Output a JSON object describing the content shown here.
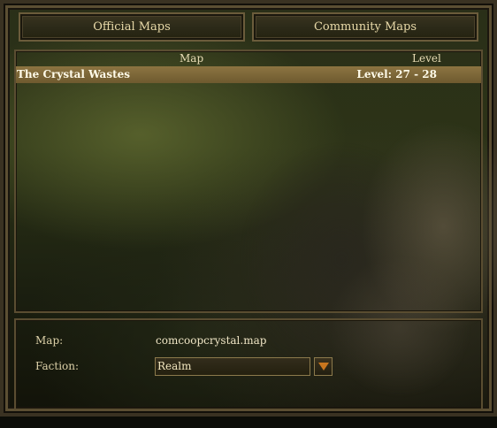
{
  "tabs": {
    "official": "Official Maps",
    "community": "Community Maps"
  },
  "table": {
    "headers": {
      "map": "Map",
      "level": "Level"
    },
    "rows": [
      {
        "name": "The Crystal Wastes",
        "level": "Level: 27 - 28"
      }
    ]
  },
  "details": {
    "map_label": "Map:",
    "map_value": "comcoopcrystal.map",
    "faction_label": "Faction:",
    "faction_value": "Realm"
  },
  "icons": {
    "dropdown": "chevron-down-icon"
  },
  "colors": {
    "accent": "#c8761e",
    "highlight_row": "#8c7441",
    "text": "#e8d9a8"
  }
}
